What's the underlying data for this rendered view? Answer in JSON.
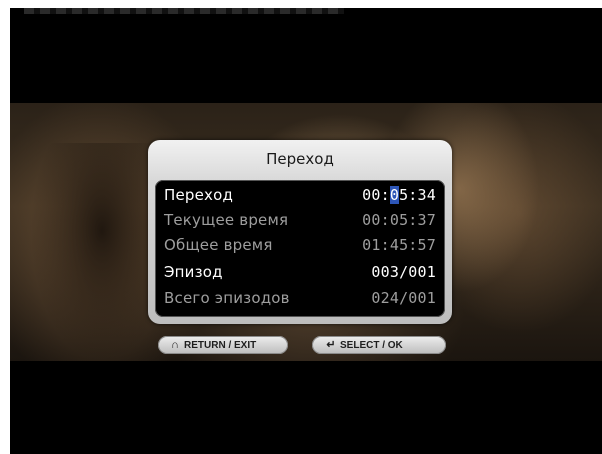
{
  "dialog": {
    "title": "Переход",
    "rows": [
      {
        "label": "Переход",
        "value_pre": "00:",
        "value_cursor": "0",
        "value_post": "5:34",
        "state": "active"
      },
      {
        "label": "Текущее время",
        "value": "00:05:37",
        "state": "dim"
      },
      {
        "label": "Общее время",
        "value": "01:45:57",
        "state": "dim"
      },
      {
        "label": "Эпизод",
        "value": "003/001",
        "state": "active"
      },
      {
        "label": "Всего эпизодов",
        "value": "024/001",
        "state": "dim"
      }
    ]
  },
  "hints": {
    "return_label": "RETURN / EXIT",
    "return_icon": "return-arrow-icon",
    "select_label": "SELECT / OK",
    "select_icon": "enter-arrow-icon"
  },
  "colors": {
    "cursor_highlight": "#2d56b8",
    "active_text": "#ffffff",
    "dim_text": "#9e9e9e",
    "dialog_frame": "#d9d9d9"
  }
}
